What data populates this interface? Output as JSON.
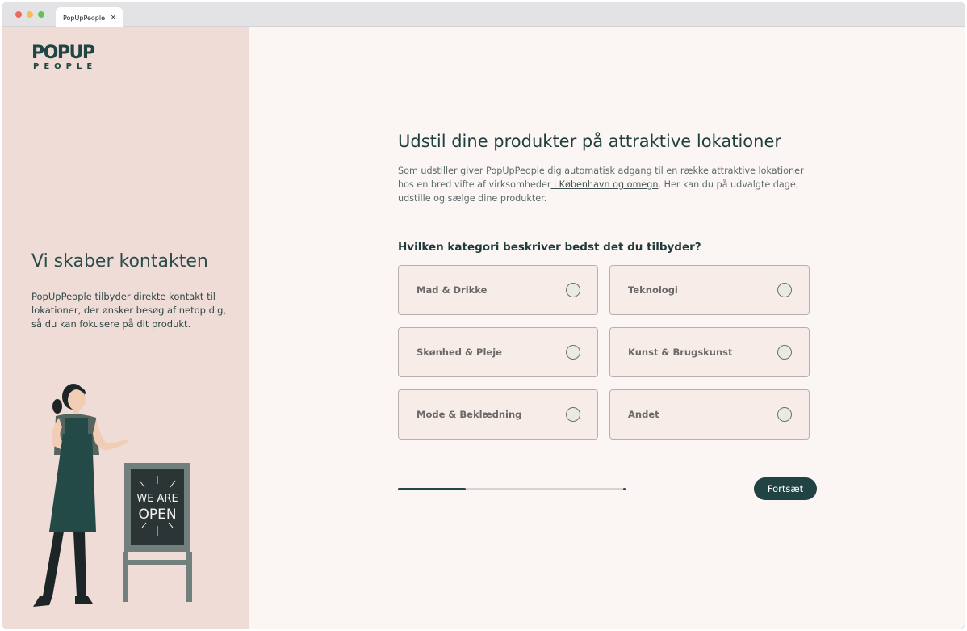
{
  "browser": {
    "tab_title": "PopUpPeople",
    "tab_close": "×"
  },
  "sidebar": {
    "logo_line1": "POPUP",
    "logo_line2": "PEOPLE",
    "title": "Vi skaber kontakten",
    "text": "PopUpPeople tilbyder direkte kontakt til lokationer, der ønsker besøg af netop dig, så du kan fokusere på dit produkt.",
    "sign_line1": "WE ARE",
    "sign_line2": "OPEN"
  },
  "main": {
    "heading": "Udstil dine produkter på attraktive lokationer",
    "intro_part1": "Som udstiller giver PopUpPeople dig automatisk adgang til en række attraktive lokationer hos en bred vifte af virksomheder",
    "intro_link": " i København og omegn",
    "intro_part2": ". Her kan du på udvalgte dage, udstille og sælge dine produkter.",
    "question": "Hvilken kategori beskriver bedst det du tilbyder?",
    "options": [
      {
        "label": "Mad & Drikke",
        "selected": false
      },
      {
        "label": "Teknologi",
        "selected": false
      },
      {
        "label": "Skønhed & Pleje",
        "selected": false
      },
      {
        "label": "Kunst & Brugskunst",
        "selected": false
      },
      {
        "label": "Mode & Beklædning",
        "selected": false
      },
      {
        "label": "Andet",
        "selected": false
      }
    ],
    "progress": 0.3,
    "continue_label": "Fortsæt"
  },
  "colors": {
    "sidebar_bg": "#efdcd6",
    "main_bg": "#fbf6f3",
    "accent": "#214344",
    "option_bg": "#f8ece8"
  }
}
